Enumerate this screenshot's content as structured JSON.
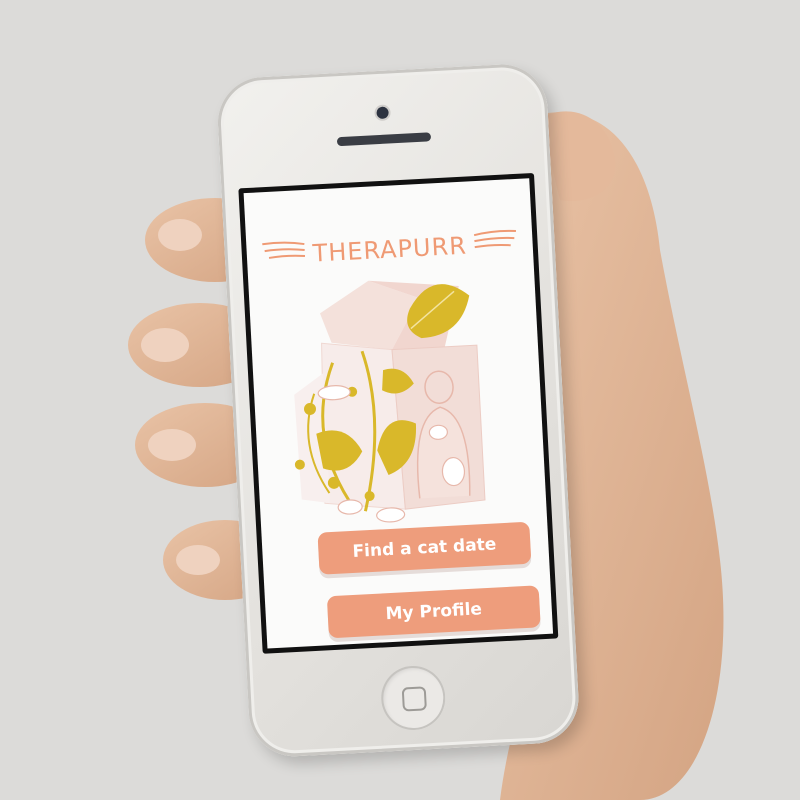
{
  "app": {
    "title": "THERAPURR",
    "find_button_label": "Find a cat date",
    "profile_button_label": "My Profile"
  },
  "colors": {
    "accent": "#ee9d7c",
    "title": "#ef9a74",
    "leaf": "#d9b82a",
    "background": "#dcdbd9"
  },
  "icons": {
    "camera": "front-camera-icon",
    "home": "home-button-icon",
    "title_lines": "speed-lines-icon"
  }
}
